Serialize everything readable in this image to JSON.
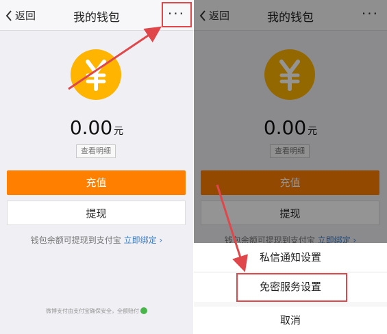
{
  "left": {
    "nav": {
      "back_label": "返回",
      "title": "我的钱包",
      "more_label": "···"
    },
    "coin_glyph": "¥",
    "balance": {
      "amount": "0.00",
      "unit": "元"
    },
    "detail_button": "查看明细",
    "recharge_button": "充值",
    "withdraw_button": "提现",
    "hint": {
      "text": "钱包余额可提现到支付宝",
      "link": "立即绑定 ›"
    },
    "footer": "微博支付由支付宝确保安全，全额赔付"
  },
  "right": {
    "nav": {
      "back_label": "返回",
      "title": "我的钱包",
      "more_label": "···"
    },
    "coin_glyph": "¥",
    "balance": {
      "amount": "0.00",
      "unit": "元"
    },
    "detail_button": "查看明细",
    "recharge_button": "充值",
    "withdraw_button": "提现",
    "hint": {
      "text": "钱包余额可提现到支付宝",
      "link": "立即绑定 ›"
    },
    "sheet": {
      "item1": "私信通知设置",
      "item2": "免密服务设置",
      "cancel": "取消"
    }
  },
  "colors": {
    "accent_orange": "#ff7f00",
    "coin_yellow": "#ffb400",
    "annotation_red": "#e0474b",
    "link_blue": "#3c7fc8"
  },
  "icons": [
    "back-chevron-icon",
    "more-dots-icon",
    "yen-coin-icon",
    "shield-check-icon"
  ]
}
